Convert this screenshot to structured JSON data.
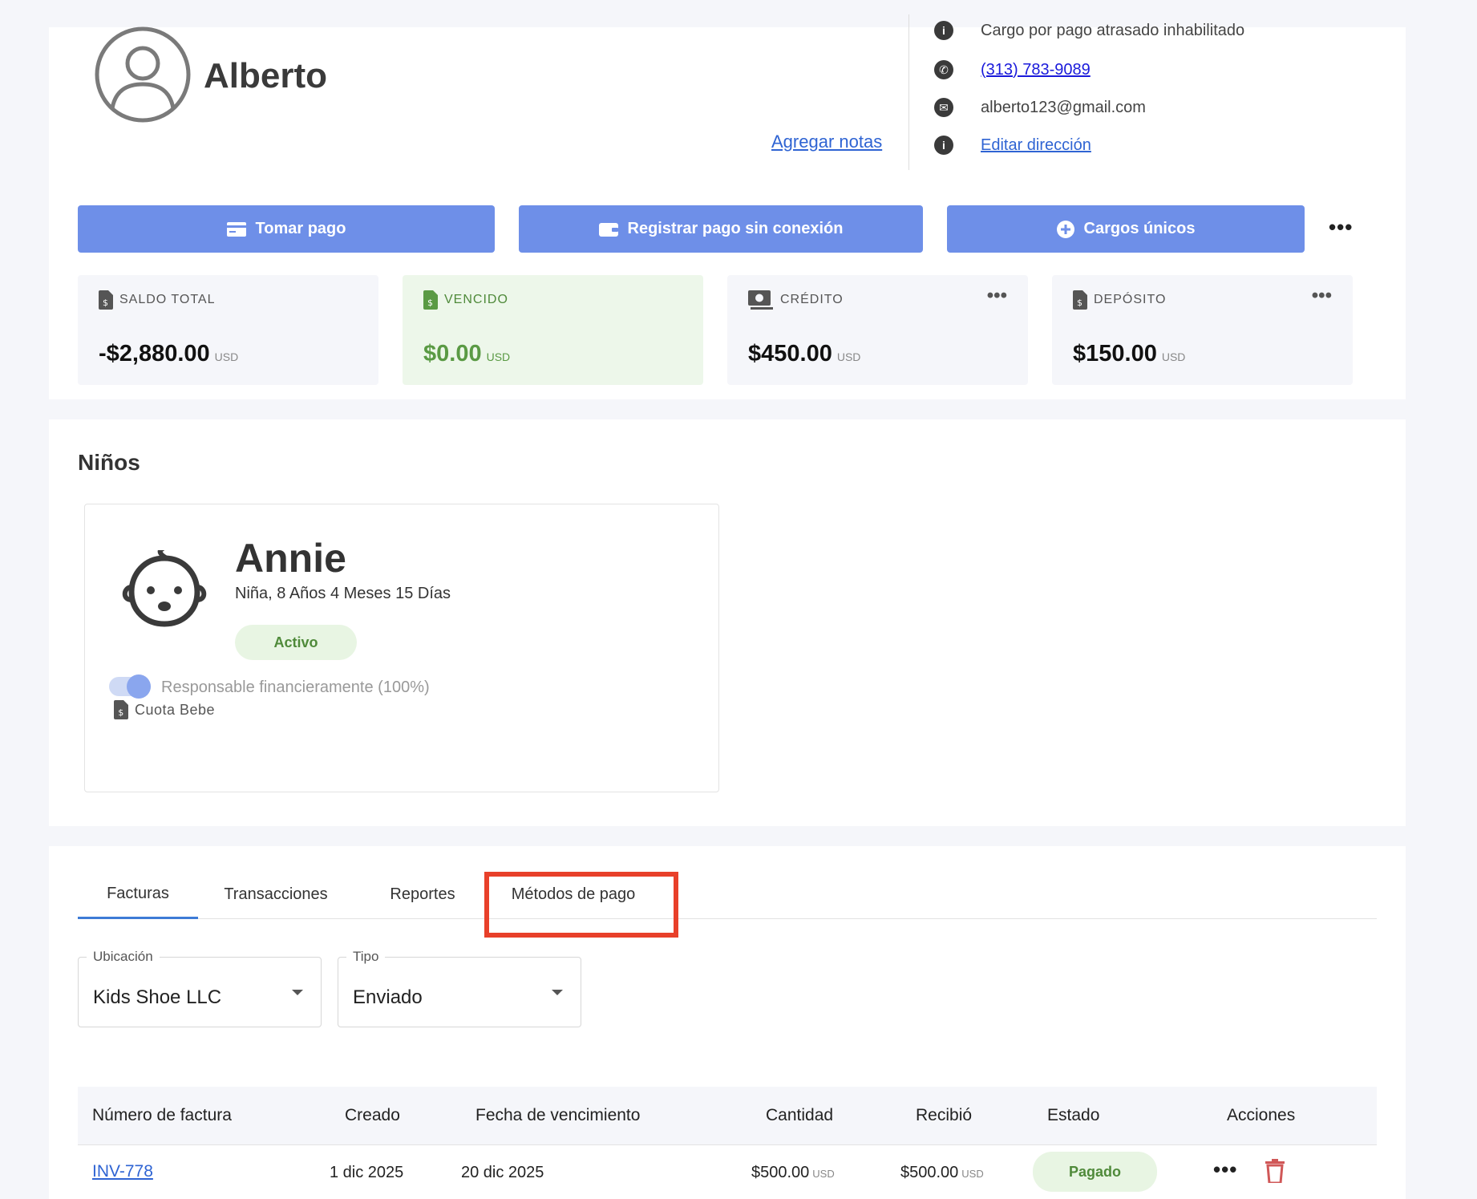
{
  "profile": {
    "name": "Alberto",
    "add_notes": "Agregar notas",
    "info": {
      "late_fee": "Cargo por pago atrasado inhabilitado",
      "phone": "(313) 783-9089",
      "email": "alberto123@gmail.com",
      "edit_address": "Editar dirección"
    }
  },
  "actions": {
    "take_payment": "Tomar pago",
    "offline_payment": "Registrar pago sin conexión",
    "one_time_charges": "Cargos únicos"
  },
  "stats": [
    {
      "label": "SALDO TOTAL",
      "value": "-$2,880.00",
      "currency": "USD"
    },
    {
      "label": "VENCIDO",
      "value": "$0.00",
      "currency": "USD"
    },
    {
      "label": "CRÉDITO",
      "value": "$450.00",
      "currency": "USD"
    },
    {
      "label": "DEPÓSITO",
      "value": "$150.00",
      "currency": "USD"
    }
  ],
  "kids": {
    "title": "Niños",
    "child": {
      "name": "Annie",
      "details": "Niña, 8 Años 4 Meses 15 Días",
      "status": "Activo",
      "responsible": "Responsable financieramente (100%)",
      "responsible_on": true,
      "fee": "Cuota Bebe"
    }
  },
  "tabs": [
    "Facturas",
    "Transacciones",
    "Reportes",
    "Métodos de pago"
  ],
  "filters": {
    "location": {
      "label": "Ubicación",
      "value": "Kids Shoe LLC"
    },
    "type": {
      "label": "Tipo",
      "value": "Enviado"
    }
  },
  "table": {
    "headers": [
      "Número de factura",
      "Creado",
      "Fecha de vencimiento",
      "Cantidad",
      "Recibió",
      "Estado",
      "Acciones"
    ],
    "rows": [
      {
        "invoice": "INV-778",
        "created": "1 dic 2025",
        "due": "20 dic 2025",
        "amount": "$500.00",
        "amount_currency": "USD",
        "received": "$500.00",
        "received_currency": "USD",
        "status": "Pagado"
      }
    ]
  },
  "colors": {
    "primary_button": "#6e8fe8",
    "success": "#5a9a44",
    "highlight_box": "#e8402a",
    "link": "#2f64d3"
  }
}
